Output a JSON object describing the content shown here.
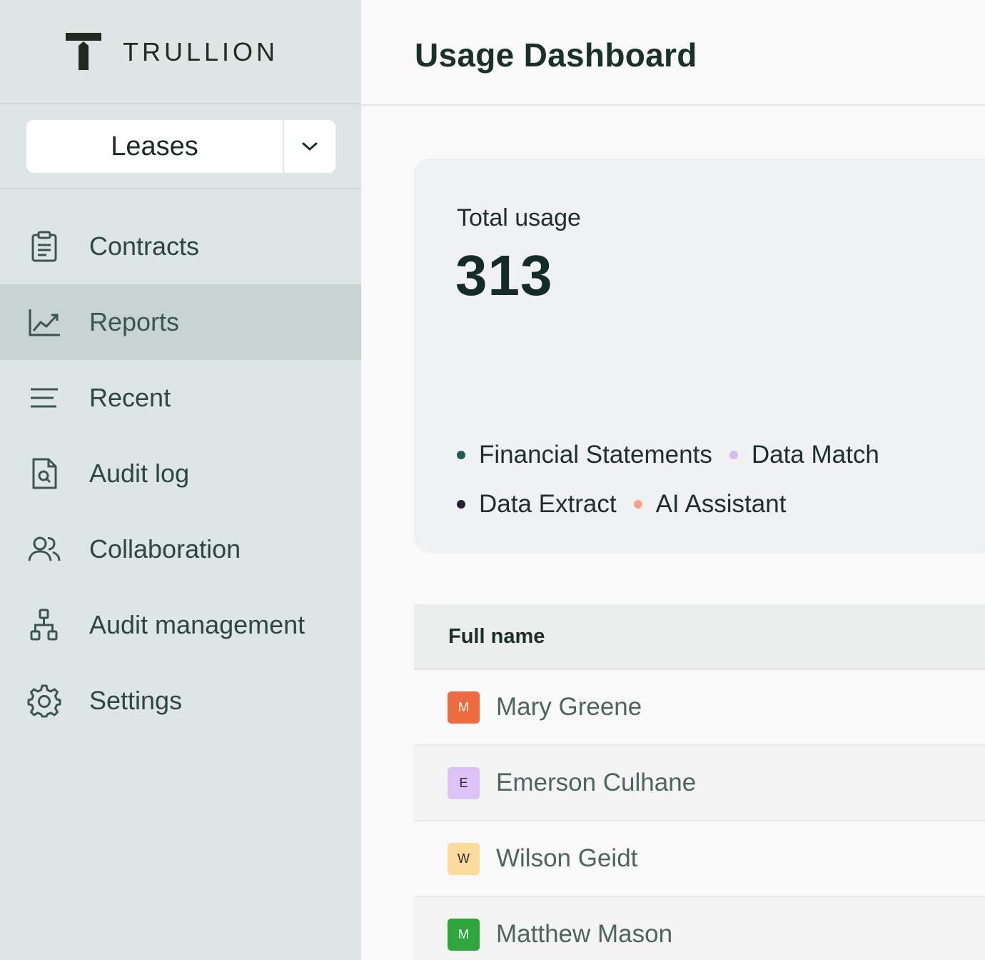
{
  "brand": {
    "name": "TRULLION"
  },
  "selector": {
    "value": "Leases",
    "caret_icon": "chevron-down-icon"
  },
  "nav": {
    "items": [
      {
        "label": "Contracts",
        "icon": "clipboard-icon",
        "active": false
      },
      {
        "label": "Reports",
        "icon": "line-chart-icon",
        "active": true
      },
      {
        "label": "Recent",
        "icon": "lines-icon",
        "active": false
      },
      {
        "label": "Audit log",
        "icon": "document-search-icon",
        "active": false
      },
      {
        "label": "Collaboration",
        "icon": "users-icon",
        "active": false
      },
      {
        "label": "Audit management",
        "icon": "hierarchy-icon",
        "active": false
      },
      {
        "label": "Settings",
        "icon": "gear-icon",
        "active": false
      }
    ]
  },
  "header": {
    "title": "Usage Dashboard"
  },
  "usage": {
    "label": "Total usage",
    "value": "313",
    "legend": [
      {
        "label": "Financial Statements",
        "color": "#1e5c5a"
      },
      {
        "label": "Data Match",
        "color": "#d8b9f2"
      },
      {
        "label": "Data Extract",
        "color": "#2a1f36"
      },
      {
        "label": "AI Assistant",
        "color": "#f6a38c"
      }
    ]
  },
  "table": {
    "column": "Full name",
    "rows": [
      {
        "initial": "M",
        "name": "Mary Greene",
        "avatar_bg": "#ec6b3f",
        "avatar_fg": "#ffffff"
      },
      {
        "initial": "E",
        "name": "Emerson Culhane",
        "avatar_bg": "#dcc2f5",
        "avatar_fg": "#2a2a2a"
      },
      {
        "initial": "W",
        "name": "Wilson Geidt",
        "avatar_bg": "#fcdc9c",
        "avatar_fg": "#2a2a2a"
      },
      {
        "initial": "M",
        "name": "Matthew Mason",
        "avatar_bg": "#2ea63c",
        "avatar_fg": "#ffffff"
      }
    ]
  }
}
